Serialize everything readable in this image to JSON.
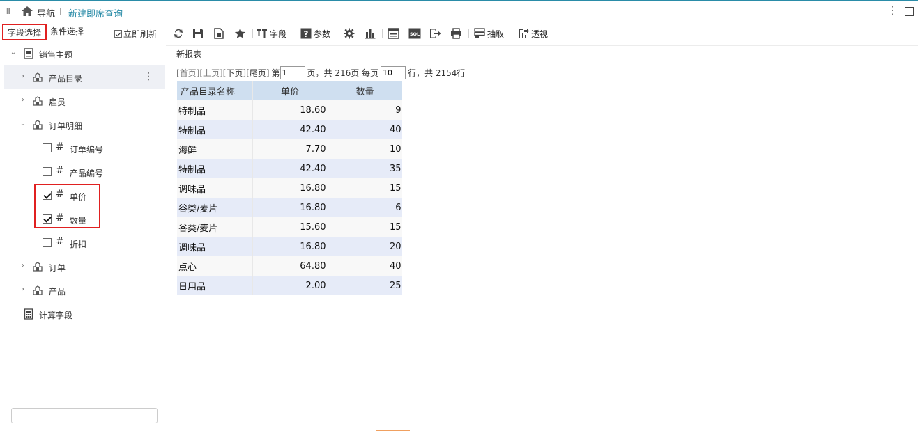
{
  "topbar": {
    "menu_glyph": "III",
    "nav_label": "导航",
    "tab_label": "新建即席查询",
    "more_glyph": "⋮"
  },
  "left_panel": {
    "tabs": [
      {
        "label": "字段选择",
        "active": true
      },
      {
        "label": "条件选择",
        "active": false
      }
    ],
    "refresh": {
      "label": "立即刷新",
      "checked": true
    },
    "tree": {
      "root": {
        "label": "销售主题",
        "icon": "subject-icon",
        "expanded": true
      },
      "nodes": [
        {
          "label": "产品目录",
          "icon": "table-icon",
          "expanded": false,
          "highlighted": true
        },
        {
          "label": "雇员",
          "icon": "table-icon",
          "expanded": false
        },
        {
          "label": "订单明细",
          "icon": "table-icon",
          "expanded": true,
          "fields": [
            {
              "label": "订单编号",
              "checked": false
            },
            {
              "label": "产品编号",
              "checked": false
            },
            {
              "label": "单价",
              "checked": true
            },
            {
              "label": "数量",
              "checked": true
            },
            {
              "label": "折扣",
              "checked": false
            }
          ]
        },
        {
          "label": "订单",
          "icon": "table-icon",
          "expanded": false
        },
        {
          "label": "产品",
          "icon": "table-icon",
          "expanded": false
        }
      ],
      "calc": {
        "label": "计算字段",
        "icon": "calculator-icon"
      }
    },
    "search": {
      "value": ""
    }
  },
  "toolbar": {
    "buttons": [
      {
        "name": "refresh-icon"
      },
      {
        "name": "save-icon"
      },
      {
        "name": "save-as-icon"
      },
      {
        "name": "favorite-icon"
      },
      {
        "name": "fields-icon",
        "label": "字段"
      },
      {
        "name": "params-icon",
        "label": "参数"
      },
      {
        "name": "settings-icon"
      },
      {
        "name": "chart-icon"
      },
      {
        "name": "layout-icon"
      },
      {
        "name": "sql-icon",
        "text": "SQL"
      },
      {
        "name": "export-icon"
      },
      {
        "name": "print-icon"
      },
      {
        "name": "extract-icon",
        "label": "抽取"
      },
      {
        "name": "pivot-icon",
        "label": "透视"
      }
    ]
  },
  "report": {
    "title": "新报表",
    "pager": {
      "first": "[首页]",
      "prev": "[上页]",
      "next": "[下页]",
      "last": "[尾页]",
      "page_prefix": "第",
      "page_value": "1",
      "page_suffix": "页，共 216页 每页",
      "page_size": "10",
      "total_suffix": "行，共 2154行"
    },
    "columns": [
      "产品目录名称",
      "单价",
      "数量"
    ],
    "rows": [
      [
        "特制品",
        "18.60",
        "9"
      ],
      [
        "特制品",
        "42.40",
        "40"
      ],
      [
        "海鲜",
        "7.70",
        "10"
      ],
      [
        "特制品",
        "42.40",
        "35"
      ],
      [
        "调味品",
        "16.80",
        "15"
      ],
      [
        "谷类/麦片",
        "16.80",
        "6"
      ],
      [
        "谷类/麦片",
        "15.60",
        "15"
      ],
      [
        "调味品",
        "16.80",
        "20"
      ],
      [
        "点心",
        "64.80",
        "40"
      ],
      [
        "日用品",
        "2.00",
        "25"
      ]
    ]
  },
  "colors": {
    "accent": "#2a8ca8",
    "highlight_red": "#e02020",
    "header_bg": "#cfdff0",
    "row_alt_bg": "#e6ebf8"
  }
}
